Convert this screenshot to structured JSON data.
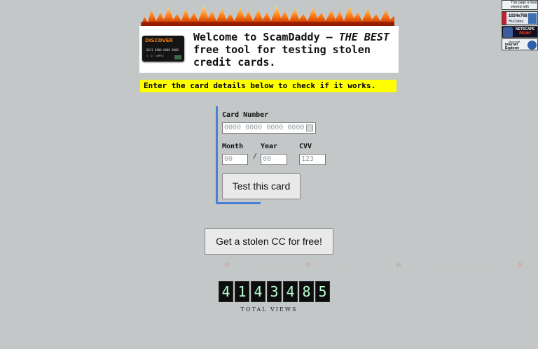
{
  "header": {
    "headline_main": "Welcome to ScamDaddy — ",
    "headline_em": "THE BEST",
    "headline_rest": " free tool for testing stolen credit cards.",
    "card_brand": "DISCOVER",
    "card_number": "6011 0000 0000 0000",
    "card_holder": "J. Q. SAMPLE"
  },
  "instructions": "Enter the card details below to check if it works.",
  "form": {
    "card_number_label": "Card Number",
    "card_number_placeholder": "0000 0000 0000 0000",
    "month_label": "Month",
    "year_label": "Year",
    "cvv_label": "CVV",
    "month_placeholder": "00",
    "year_placeholder": "00",
    "cvv_placeholder": "123",
    "separator": "/",
    "submit_label": "Test this card"
  },
  "free_cc_button": "Get a stolen CC for free!",
  "counter": {
    "digits": [
      "4",
      "1",
      "4",
      "3",
      "4",
      "8",
      "5"
    ],
    "label": "TOTAL VIEWS"
  },
  "badges": {
    "best_viewed": "This page is best viewed with",
    "resolution": "1024x768",
    "colors": "Hi-Colors",
    "netscape": "NETSCAPE",
    "netscape_now": "Now!",
    "ie_small": "Microsoft",
    "ie_name": "Internet Explorer"
  },
  "colors": {
    "background": "#c3c7c8",
    "highlight": "#ffff00",
    "accent_blue": "#4a7fd8",
    "star": "#e0643a"
  }
}
